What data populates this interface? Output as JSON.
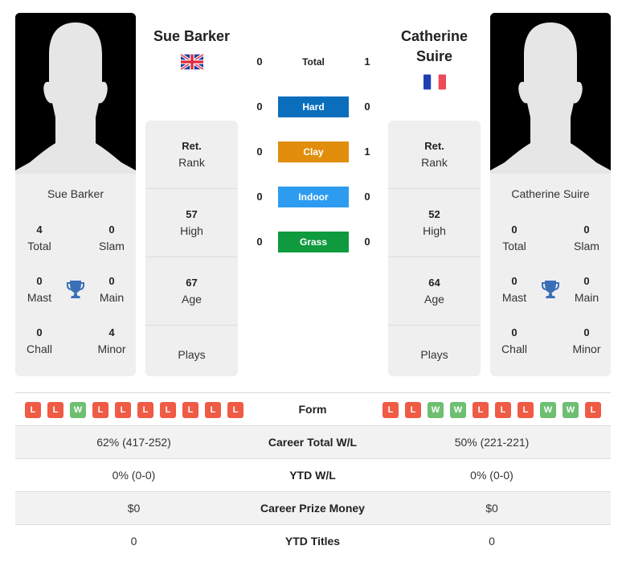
{
  "player1": {
    "name": "Sue Barker",
    "card_name": "Sue Barker",
    "flag": "gb-flag",
    "rank": {
      "value": "Ret.",
      "label": "Rank"
    },
    "high": {
      "value": "57",
      "label": "High"
    },
    "age": {
      "value": "67",
      "label": "Age"
    },
    "plays": {
      "value": "",
      "label": "Plays"
    },
    "titles": {
      "total": {
        "value": "4",
        "label": "Total"
      },
      "slam": {
        "value": "0",
        "label": "Slam"
      },
      "mast": {
        "value": "0",
        "label": "Mast"
      },
      "main": {
        "value": "0",
        "label": "Main"
      },
      "chall": {
        "value": "0",
        "label": "Chall"
      },
      "minor": {
        "value": "4",
        "label": "Minor"
      }
    },
    "form": [
      "L",
      "L",
      "W",
      "L",
      "L",
      "L",
      "L",
      "L",
      "L",
      "L"
    ]
  },
  "player2": {
    "name": "Catherine Suire",
    "card_name": "Catherine Suire",
    "flag": "fr-flag",
    "rank": {
      "value": "Ret.",
      "label": "Rank"
    },
    "high": {
      "value": "52",
      "label": "High"
    },
    "age": {
      "value": "64",
      "label": "Age"
    },
    "plays": {
      "value": "",
      "label": "Plays"
    },
    "titles": {
      "total": {
        "value": "0",
        "label": "Total"
      },
      "slam": {
        "value": "0",
        "label": "Slam"
      },
      "mast": {
        "value": "0",
        "label": "Mast"
      },
      "main": {
        "value": "0",
        "label": "Main"
      },
      "chall": {
        "value": "0",
        "label": "Chall"
      },
      "minor": {
        "value": "0",
        "label": "Minor"
      }
    },
    "form": [
      "L",
      "L",
      "W",
      "W",
      "L",
      "L",
      "L",
      "W",
      "W",
      "L"
    ]
  },
  "h2h": [
    {
      "label": "Total",
      "p1": "0",
      "p2": "1",
      "color": ""
    },
    {
      "label": "Hard",
      "p1": "0",
      "p2": "0",
      "color": "#0a6ebd"
    },
    {
      "label": "Clay",
      "p1": "0",
      "p2": "1",
      "color": "#e08e0b"
    },
    {
      "label": "Indoor",
      "p1": "0",
      "p2": "0",
      "color": "#2d9cf0"
    },
    {
      "label": "Grass",
      "p1": "0",
      "p2": "0",
      "color": "#0f9a3e"
    }
  ],
  "table": {
    "form_label": "Form",
    "rows": [
      {
        "label": "Career Total W/L",
        "p1": "62% (417-252)",
        "p2": "50% (221-221)"
      },
      {
        "label": "YTD W/L",
        "p1": "0% (0-0)",
        "p2": "0% (0-0)"
      },
      {
        "label": "Career Prize Money",
        "p1": "$0",
        "p2": "$0"
      },
      {
        "label": "YTD Titles",
        "p1": "0",
        "p2": "0"
      }
    ]
  },
  "colors": {
    "loss": "#ef5b44",
    "win": "#6ebf72",
    "trophy": "#3a6fb8"
  }
}
